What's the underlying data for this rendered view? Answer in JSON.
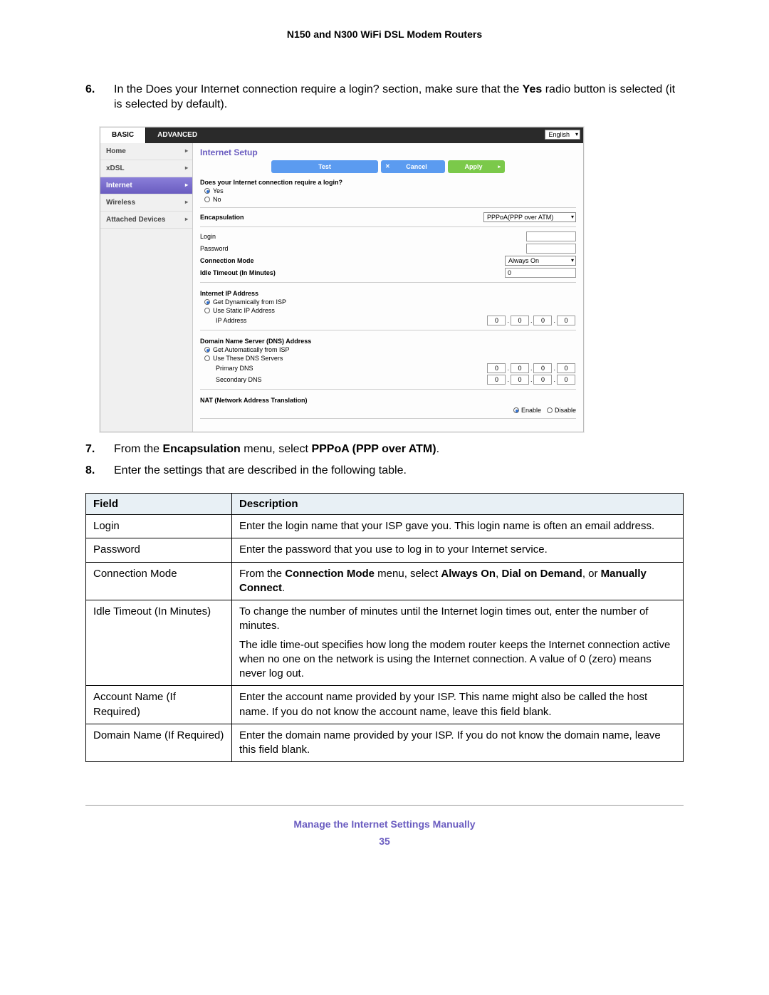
{
  "doc_title": "N150 and N300 WiFi DSL Modem Routers",
  "steps": {
    "s6": {
      "num": "6.",
      "pre": "In the Does your Internet connection require a login? section, make sure that the ",
      "bold": "Yes",
      "post": " radio button is selected (it is selected by default)."
    },
    "s7": {
      "num": "7.",
      "pre": "From the ",
      "b1": "Encapsulation",
      "mid": " menu, select ",
      "b2": "PPPoA (PPP over ATM)",
      "post": "."
    },
    "s8": {
      "num": "8.",
      "text": "Enter the settings that are described in the following table."
    }
  },
  "ui": {
    "tab_basic": "BASIC",
    "tab_advanced": "ADVANCED",
    "lang": "English",
    "side": [
      "Home",
      "xDSL",
      "Internet",
      "Wireless",
      "Attached Devices"
    ],
    "title": "Internet Setup",
    "btn_test": "Test",
    "btn_cancel": "Cancel",
    "btn_apply": "Apply",
    "q_login": "Does your Internet connection require a login?",
    "opt_yes": "Yes",
    "opt_no": "No",
    "lbl_encap": "Encapsulation",
    "val_encap": "PPPoA(PPP over ATM)",
    "lbl_login": "Login",
    "lbl_password": "Password",
    "lbl_connmode": "Connection Mode",
    "val_connmode": "Always On",
    "lbl_idle": "Idle Timeout (In Minutes)",
    "val_idle": "0",
    "sect_ip": "Internet IP Address",
    "opt_dynip": "Get Dynamically from ISP",
    "opt_staticip": "Use Static IP Address",
    "lbl_ipaddr": "IP Address",
    "sect_dns": "Domain Name Server (DNS) Address",
    "opt_autodns": "Get Automatically from ISP",
    "opt_usedns": "Use These DNS Servers",
    "lbl_primdns": "Primary DNS",
    "lbl_secdns": "Secondary DNS",
    "sect_nat": "NAT (Network Address Translation)",
    "opt_enable": "Enable",
    "opt_disable": "Disable",
    "oct": "0"
  },
  "table": {
    "h_field": "Field",
    "h_desc": "Description",
    "rows": [
      {
        "field": "Login",
        "desc": "Enter the login name that your ISP gave you. This login name is often an email address."
      },
      {
        "field": "Password",
        "desc": "Enter the password that you use to log in to your Internet service."
      },
      {
        "field": "Connection Mode",
        "desc_pre": "From the ",
        "b1": "Connection Mode",
        "mid1": " menu, select ",
        "b2": "Always On",
        "sep1": ", ",
        "b3": "Dial on Demand",
        "sep2": ", or ",
        "b4": "Manually Connect",
        "post": "."
      },
      {
        "field": "Idle Timeout (In Minutes)",
        "desc1": "To change the number of minutes until the Internet login times out, enter the number of minutes.",
        "desc2": "The idle time-out specifies how long the modem router keeps the Internet connection active when no one on the network is using the Internet connection. A value of 0 (zero) means never log out."
      },
      {
        "field": "Account Name (If Required)",
        "desc": "Enter the account name provided by your ISP. This name might also be called the host name. If you do not know the account name, leave this field blank."
      },
      {
        "field": "Domain Name (If Required)",
        "desc": "Enter the domain name provided by your ISP. If you do not know the domain name, leave this field blank."
      }
    ]
  },
  "footer": "Manage the Internet Settings Manually",
  "pagenum": "35"
}
